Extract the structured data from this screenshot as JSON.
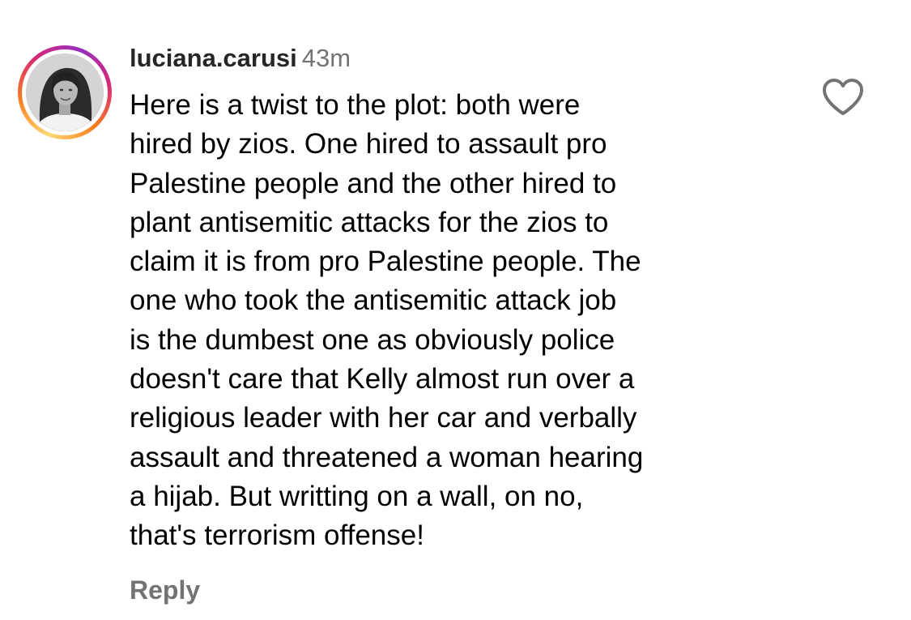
{
  "comment": {
    "username": "luciana.carusi",
    "timestamp": "43m",
    "avatar_ring_colors": [
      "#feda75",
      "#fa7e1e",
      "#d62976",
      "#962fbf"
    ],
    "text_lines": [
      "Here is a twist to the plot: both were",
      "hired by zios. One hired to assault pro",
      "Palestine people and the other hired to",
      "plant antisemitic attacks for the zios to",
      "claim it is from pro Palestine people. The",
      "one who took the antisemitic attack job",
      "is the dumbest one as obviously police",
      "doesn't care that Kelly almost run over a",
      "religious leader with her car and verbally",
      "assault and threatened a woman hearing",
      "a hijab. But writting on a wall, on no,",
      "that's terrorism offense!"
    ],
    "reply_label": "Reply",
    "like_icon": "heart-outline-icon"
  }
}
